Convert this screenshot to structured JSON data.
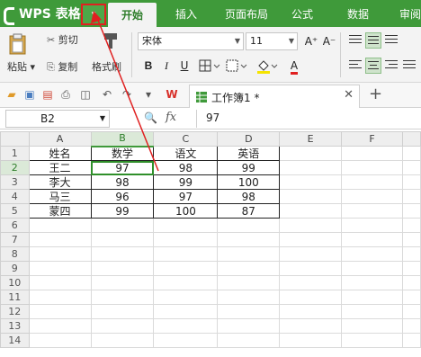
{
  "app": {
    "title": "WPS 表格",
    "menu_arrow": "▾"
  },
  "tabs": [
    "开始",
    "插入",
    "页面布局",
    "公式",
    "数据",
    "审阅"
  ],
  "ribbon": {
    "cut": "剪切",
    "copy": "复制",
    "format_painter": "格式刷",
    "paste": "粘贴",
    "font_name": "宋体",
    "font_size": "11",
    "bold": "B",
    "italic": "I",
    "underline": "U",
    "grow_font": "A⁺",
    "shrink_font": "A⁻",
    "font_color_glyph": "A"
  },
  "doc_tab": {
    "label": "工作簿1 *",
    "close": "✕",
    "new": "+"
  },
  "formula_bar": {
    "cell_ref": "B2",
    "fx": "fx",
    "value": "97"
  },
  "sheet": {
    "columns": [
      "A",
      "B",
      "C",
      "D",
      "E",
      "F"
    ],
    "rows": [
      "1",
      "2",
      "3",
      "4",
      "5",
      "6",
      "7",
      "8",
      "9",
      "10",
      "11",
      "12",
      "13",
      "14"
    ],
    "data": [
      [
        "姓名",
        "数学",
        "语文",
        "英语"
      ],
      [
        "王二",
        "97",
        "98",
        "99"
      ],
      [
        "李大",
        "98",
        "99",
        "100"
      ],
      [
        "马三",
        "96",
        "97",
        "98"
      ],
      [
        "蒙四",
        "99",
        "100",
        "87"
      ]
    ]
  },
  "colors": {
    "brand": "#3f9a3a",
    "annotation": "#e02020"
  }
}
